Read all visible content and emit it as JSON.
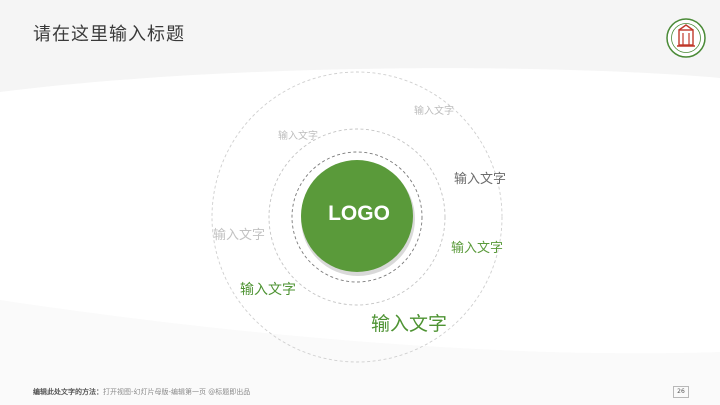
{
  "slide": {
    "title": "请在这里输入标题",
    "center_label": "LOGO",
    "labels": [
      {
        "text": "输入文字",
        "color": "#bdbdbd"
      },
      {
        "text": "输入文字",
        "color": "#bdbdbd"
      },
      {
        "text": "输入文字",
        "color": "#6b6b6b"
      },
      {
        "text": "输入文字",
        "color": "#5a9a3a"
      },
      {
        "text": "输入文字",
        "color": "#c2c2c2"
      },
      {
        "text": "输入文字",
        "color": "#4e9333"
      },
      {
        "text": "输入文字",
        "color": "#4e9333"
      }
    ],
    "footer": {
      "bold": "编辑此处文字的方法：",
      "text": "打开视图-幻灯片母版-编辑第一页 @标题即出品"
    },
    "page_number": "26"
  },
  "colors": {
    "accent": "#5a9a3a",
    "ring": "#c8c8c8",
    "title": "#3a3a3a"
  },
  "icons": {
    "logo_badge": "university-seal-icon"
  }
}
